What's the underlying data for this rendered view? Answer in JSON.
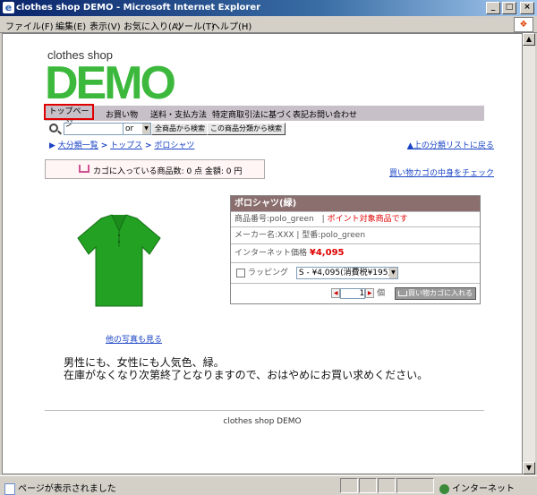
{
  "window": {
    "title": "clothes shop DEMO - Microsoft Internet Explorer"
  },
  "menu": [
    "ファイル(F)",
    "編集(E)",
    "表示(V)",
    "お気に入り(A)",
    "ツール(T)",
    "ヘルプ(H)"
  ],
  "logo": {
    "small": "clothes shop",
    "big": "DEMO"
  },
  "nav": [
    "トップページ",
    "お買い物",
    "送料・支払方法",
    "特定商取引法に基づく表記",
    "お問い合わせ"
  ],
  "search": {
    "or_option": "or",
    "all_button": "全商品から検索",
    "category_button": "この商品分類から検索"
  },
  "breadcrumb": [
    "大分類一覧",
    "トップス",
    "ポロシャツ"
  ],
  "breadcrumb_sep": ">",
  "up_link": "上の分類リストに戻る",
  "cart": {
    "label": "カゴに入っている商品数: 0 点  金額: 0 円",
    "check_link": "買い物カゴの中身をチェック"
  },
  "more_photos": "他の写真も見る",
  "product": {
    "title": "ポロシャツ(緑)",
    "number_label": "商品番号:polo_green",
    "point_label": "ポイント対象商品です",
    "maker_label": "メーカー名:XXX | 型番:polo_green",
    "price_label": "インターネット価格",
    "price": "¥4,095",
    "wrapping_label": "ラッピング",
    "option_selected": "S - ¥4,095(消費税¥195)",
    "quantity": "1",
    "unit": "個",
    "add_to_cart": "買い物カゴに入れる"
  },
  "description": [
    "男性にも、女性にも人気色、緑。",
    "在庫がなくなり次第終了となりますので、おはやめにお買い求めください。"
  ],
  "footer": "clothes shop DEMO",
  "status": {
    "left": "ページが表示されました",
    "right": "インターネット"
  },
  "colors": {
    "logo_green": "#3cb83c",
    "nav_bg": "#c8c0c8",
    "product_header": "#8b6f6f",
    "link": "#1a44c4",
    "price": "#e00000"
  }
}
